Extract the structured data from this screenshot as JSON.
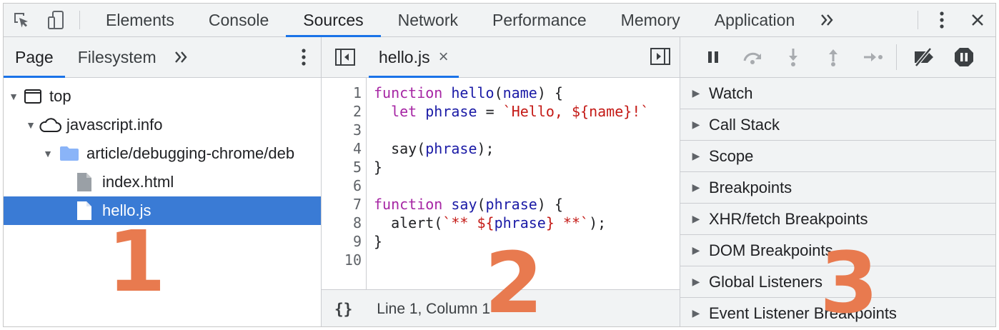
{
  "toolbar": {
    "tabs": [
      "Elements",
      "Console",
      "Sources",
      "Network",
      "Performance",
      "Memory",
      "Application"
    ],
    "active_tab": "Sources",
    "more_icon": "chevrons-right-icon",
    "menu_icon": "kebab-icon",
    "close_icon": "close-icon"
  },
  "navigator": {
    "tabs": [
      "Page",
      "Filesystem"
    ],
    "active_tab": "Page",
    "tree": [
      {
        "label": "top",
        "icon": "frame-icon",
        "expanded": true
      },
      {
        "label": "javascript.info",
        "icon": "cloud-icon",
        "expanded": true
      },
      {
        "label": "article/debugging-chrome/deb",
        "icon": "folder-icon",
        "expanded": true
      },
      {
        "label": "index.html",
        "icon": "file-icon"
      },
      {
        "label": "hello.js",
        "icon": "file-icon",
        "selected": true
      }
    ],
    "marker": "1"
  },
  "editor": {
    "file_tab": "hello.js",
    "close_glyph": "×",
    "lines": [
      "1",
      "2",
      "3",
      "4",
      "5",
      "6",
      "7",
      "8",
      "9",
      "10"
    ],
    "status_braces": "{}",
    "status_text": "Line 1, Column 1",
    "marker": "2"
  },
  "debugger": {
    "panes": [
      "Watch",
      "Call Stack",
      "Scope",
      "Breakpoints",
      "XHR/fetch Breakpoints",
      "DOM Breakpoints",
      "Global Listeners",
      "Event Listener Breakpoints"
    ],
    "marker": "3"
  },
  "colors": {
    "accent": "#1a73e8",
    "selection": "#3a7bd5",
    "marker": "#e87a4f"
  }
}
